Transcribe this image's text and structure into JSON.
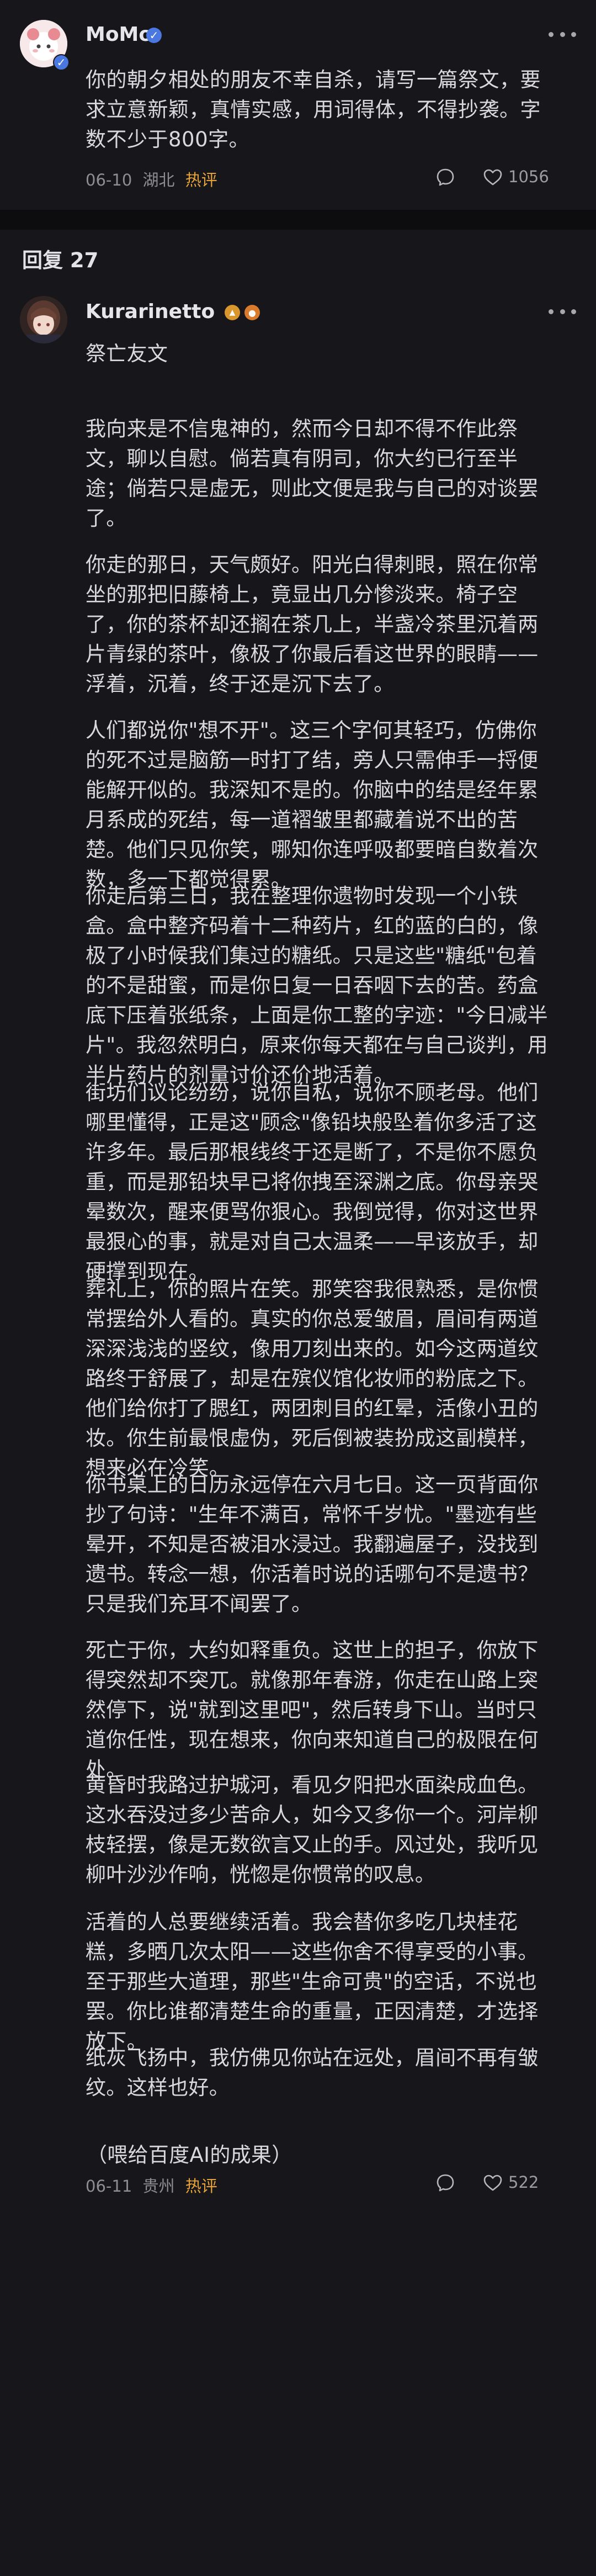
{
  "post": {
    "username": "MoMo",
    "text": "你的朝夕相处的朋友不幸自杀，请写一篇祭文，要求立意新颖，真情实感，用词得体，不得抄袭。字数不少于800字。",
    "date": "06-10",
    "location": "湖北",
    "hot_label": "热评",
    "likes": "1056"
  },
  "reply_header": "回复 27",
  "reply": {
    "username": "Kurarinetto",
    "title": "祭亡友文",
    "paragraphs": [
      "我向来是不信鬼神的，然而今日却不得不作此祭文，聊以自慰。倘若真有阴司，你大约已行至半途；倘若只是虚无，则此文便是我与自己的对谈罢了。",
      "你走的那日，天气颇好。阳光白得刺眼，照在你常坐的那把旧藤椅上，竟显出几分惨淡来。椅子空了，你的茶杯却还搁在茶几上，半盏冷茶里沉着两片青绿的茶叶，像极了你最后看这世界的眼睛——浮着，沉着，终于还是沉下去了。",
      "人们都说你\"想不开\"。这三个字何其轻巧，仿佛你的死不过是脑筋一时打了结，旁人只需伸手一捋便能解开似的。我深知不是的。你脑中的结是经年累月系成的死结，每一道褶皱里都藏着说不出的苦楚。他们只见你笑，哪知你连呼吸都要暗自数着次数，多一下都觉得累。",
      "你走后第三日，我在整理你遗物时发现一个小铁盒。盒中整齐码着十二种药片，红的蓝的白的，像极了小时候我们集过的糖纸。只是这些\"糖纸\"包着的不是甜蜜，而是你日复一日吞咽下去的苦。药盒底下压着张纸条，上面是你工整的字迹：\"今日减半片\"。我忽然明白，原来你每天都在与自己谈判，用半片药片的剂量讨价还价地活着。",
      "街坊们议论纷纷，说你自私，说你不顾老母。他们哪里懂得，正是这\"顾念\"像铅块般坠着你多活了这许多年。最后那根线终于还是断了，不是你不愿负重，而是那铅块早已将你拽至深渊之底。你母亲哭晕数次，醒来便骂你狠心。我倒觉得，你对这世界最狠心的事，就是对自己太温柔——早该放手，却硬撑到现在。",
      "葬礼上，你的照片在笑。那笑容我很熟悉，是你惯常摆给外人看的。真实的你总爱皱眉，眉间有两道深深浅浅的竖纹，像用刀刻出来的。如今这两道纹路终于舒展了，却是在殡仪馆化妆师的粉底之下。他们给你打了腮红，两团刺目的红晕，活像小丑的妆。你生前最恨虚伪，死后倒被装扮成这副模样，想来必在冷笑。",
      "你书桌上的日历永远停在六月七日。这一页背面你抄了句诗：\"生年不满百，常怀千岁忧。\"墨迹有些晕开，不知是否被泪水浸过。我翻遍屋子，没找到遗书。转念一想，你活着时说的话哪句不是遗书？只是我们充耳不闻罢了。",
      "死亡于你，大约如释重负。这世上的担子，你放下得突然却不突兀。就像那年春游，你走在山路上突然停下，说\"就到这里吧\"，然后转身下山。当时只道你任性，现在想来，你向来知道自己的极限在何处。",
      "黄昏时我路过护城河，看见夕阳把水面染成血色。这水吞没过多少苦命人，如今又多你一个。河岸柳枝轻摆，像是无数欲言又止的手。风过处，我听见柳叶沙沙作响，恍惚是你惯常的叹息。",
      "活着的人总要继续活着。我会替你多吃几块桂花糕，多晒几次太阳——这些你舍不得享受的小事。至于那些大道理，那些\"生命可贵\"的空话，不说也罢。你比谁都清楚生命的重量，正因清楚，才选择放下。",
      "纸灰飞扬中，我仿佛见你站在远处，眉间不再有皱纹。这样也好。",
      "（喂给百度AI的成果）"
    ],
    "date": "06-11",
    "location": "贵州",
    "hot_label": "热评",
    "likes": "522"
  },
  "colors": {
    "background": "#17171b",
    "separator": "#0d0d10",
    "text": "#d9d9dc",
    "meta": "#8d8d93",
    "hot": "#e7a33a",
    "verified": "#4a78e0",
    "level_badge": "#d9962c"
  },
  "icons": {
    "menu": "more-dots-icon",
    "comment": "comment-bubble-icon",
    "like": "heart-icon",
    "verified": "verified-badge-icon",
    "level": "level-badge-icon"
  }
}
